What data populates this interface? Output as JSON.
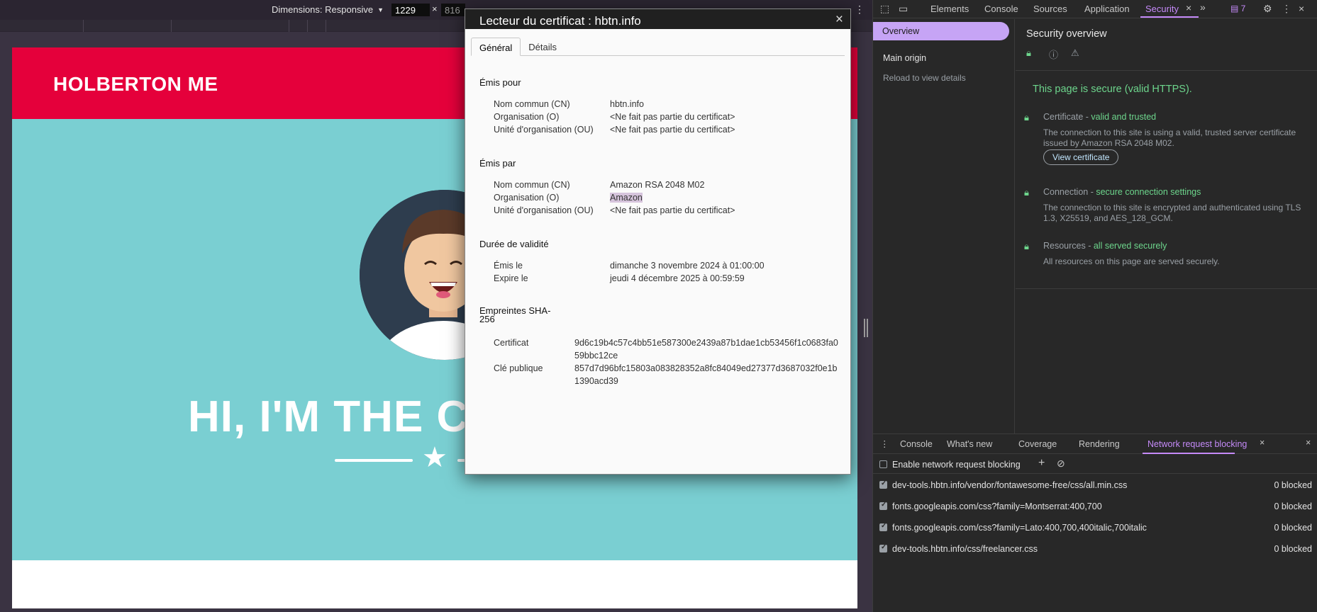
{
  "emulation": {
    "dimensions_label": "Dimensions: Responsive",
    "width_value": "1229",
    "times": "×",
    "height_value": "816"
  },
  "site": {
    "logo": "HOLBERTON ME",
    "hero_title": "HI, I'M THE C"
  },
  "certificate_dialog": {
    "title": "Lecteur du certificat : hbtn.info",
    "close": "×",
    "tabs": [
      "Général",
      "Détails"
    ],
    "issued_to": {
      "title": "Émis pour",
      "rows": [
        {
          "label": "Nom commun (CN)",
          "value": "hbtn.info"
        },
        {
          "label": "Organisation (O)",
          "value": "<Ne fait pas partie du certificat>"
        },
        {
          "label": "Unité d'organisation (OU)",
          "value": "<Ne fait pas partie du certificat>"
        }
      ]
    },
    "issued_by": {
      "title": "Émis par",
      "rows": [
        {
          "label": "Nom commun (CN)",
          "value": "Amazon RSA 2048 M02"
        },
        {
          "label": "Organisation (O)",
          "value": "Amazon"
        },
        {
          "label": "Unité d'organisation (OU)",
          "value": "<Ne fait pas partie du certificat>"
        }
      ]
    },
    "validity": {
      "title": "Durée de validité",
      "rows": [
        {
          "label": "Émis le",
          "value": "dimanche 3 novembre 2024 à 01:00:00"
        },
        {
          "label": "Expire le",
          "value": "jeudi 4 décembre 2025 à 00:59:59"
        }
      ]
    },
    "fingerprints": {
      "title_line1": "Empreintes SHA-",
      "title_line2": "256",
      "rows": [
        {
          "label": "Certificat",
          "value": "9d6c19b4c57c4bb51e587300e2439a87b1dae1cb53456f1c0683fa059bbc12ce"
        },
        {
          "label": "Clé publique",
          "value": "857d7d96bfc15803a083828352a8fc84049ed27377d3687032f0e1b1390acd39"
        }
      ]
    }
  },
  "devtools": {
    "tabs": [
      "Elements",
      "Console",
      "Sources",
      "Application",
      "Security"
    ],
    "active_tab": "Security",
    "issues_badge": "7",
    "sidebar": {
      "overview": "Overview",
      "main_origin": "Main origin",
      "reload": "Reload to view details"
    },
    "overview": {
      "title": "Security overview",
      "secure_message": "This page is secure (valid HTTPS).",
      "certificate": {
        "label": "Certificate - ",
        "status": "valid and trusted",
        "desc": "The connection to this site is using a valid, trusted server certificate issued by Amazon RSA 2048 M02.",
        "button": "View certificate"
      },
      "connection": {
        "label": "Connection - ",
        "status": "secure connection settings",
        "desc": "The connection to this site is encrypted and authenticated using TLS 1.3, X25519, and AES_128_GCM."
      },
      "resources": {
        "label": "Resources - ",
        "status": "all served securely",
        "desc": "All resources on this page are served securely."
      }
    },
    "drawer": {
      "tabs": [
        "Console",
        "What's new",
        "Coverage",
        "Rendering",
        "Network request blocking"
      ],
      "active_tab": "Network request blocking",
      "enable_label": "Enable network request blocking",
      "rules": [
        {
          "url": "dev-tools.hbtn.info/vendor/fontawesome-free/css/all.min.css",
          "count": "0 blocked",
          "checked": true
        },
        {
          "url": "fonts.googleapis.com/css?family=Montserrat:400,700",
          "count": "0 blocked",
          "checked": true
        },
        {
          "url": "fonts.googleapis.com/css?family=Lato:400,700,400italic,700italic",
          "count": "0 blocked",
          "checked": true
        },
        {
          "url": "dev-tools.hbtn.info/css/freelancer.css",
          "count": "0 blocked",
          "checked": true
        }
      ]
    }
  },
  "colors": {
    "brand_red": "#e5003b",
    "hero_teal": "#7acfd2",
    "devtools_accent": "#c58af9",
    "secure_green": "#6dd58c"
  }
}
